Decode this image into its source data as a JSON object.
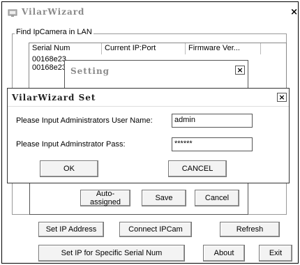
{
  "main": {
    "title": "VilarWizard",
    "group_label": "Find IpCamera in LAN",
    "columns": [
      "Serial Num",
      "Current IP:Port",
      "Firmware Ver..."
    ],
    "rows": [
      {
        "serial": "00168e23"
      },
      {
        "serial": "00168e23"
      }
    ],
    "buttons": {
      "set_ip": "Set IP Address",
      "connect": "Connect IPCam",
      "refresh": "Refresh",
      "set_ip_serial": "Set IP for Specific Serial Num",
      "about": "About",
      "exit": "Exit"
    }
  },
  "setting_dialog": {
    "title": "Setting",
    "buttons": {
      "auto": "Auto-assigned",
      "save": "Save",
      "cancel": "Cancel"
    }
  },
  "set_dialog": {
    "title": "VilarWizard Set",
    "user_label": "Please Input Administrators User Name:",
    "user_value": "admin",
    "pass_label": "Please Input Adminstrator Pass:",
    "pass_value": "******",
    "ok": "OK",
    "cancel": "CANCEL"
  },
  "icons": {
    "app": "app-icon",
    "close": "close-icon"
  }
}
